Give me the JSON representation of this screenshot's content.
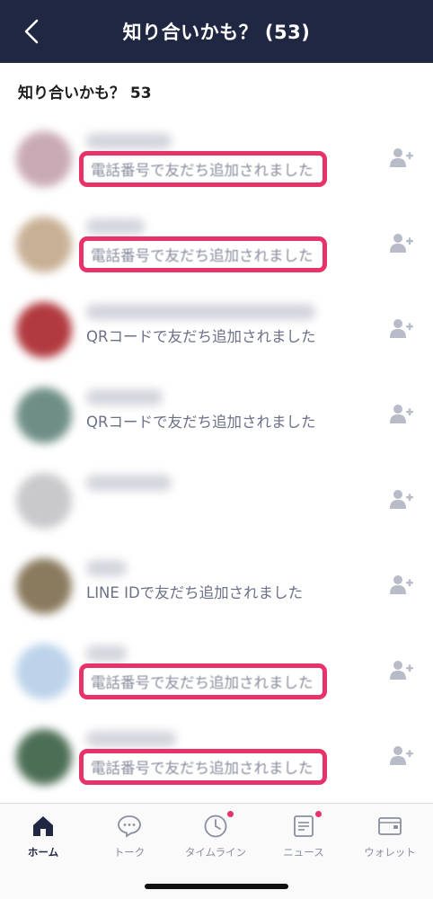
{
  "header": {
    "title": "知り合いかも？ (53)",
    "back_icon": "chevron-left-icon"
  },
  "section": {
    "title": "知り合いかも？ 53"
  },
  "suggestions": [
    {
      "avatar_color": "#c9aab4",
      "name_width": 95,
      "source": "電話番号で友だち追加されました",
      "highlighted": true
    },
    {
      "avatar_color": "#c8b095",
      "name_width": 65,
      "source": "電話番号で友だち追加されました",
      "highlighted": true
    },
    {
      "avatar_color": "#b13a3f",
      "name_width": 255,
      "source": "QRコードで友だち追加されました",
      "highlighted": false
    },
    {
      "avatar_color": "#6f8f86",
      "name_width": 85,
      "source": "QRコードで友だち追加されました",
      "highlighted": false
    },
    {
      "avatar_color": "#c9c9cc",
      "name_width": 95,
      "source": "",
      "highlighted": false
    },
    {
      "avatar_color": "#8a7a5e",
      "name_width": 45,
      "source": "LINE IDで友だち追加されました",
      "highlighted": false
    },
    {
      "avatar_color": "#bcd3ea",
      "name_width": 45,
      "source": "電話番号で友だち追加されました",
      "highlighted": true
    },
    {
      "avatar_color": "#4c6e55",
      "name_width": 100,
      "source": "電話番号で友だち追加されました",
      "highlighted": true
    }
  ],
  "tabs": [
    {
      "label": "ホーム",
      "icon": "home-icon",
      "active": true,
      "badge": false
    },
    {
      "label": "トーク",
      "icon": "chat-bubble-icon",
      "active": false,
      "badge": false
    },
    {
      "label": "タイムライン",
      "icon": "clock-icon",
      "active": false,
      "badge": true
    },
    {
      "label": "ニュース",
      "icon": "news-icon",
      "active": false,
      "badge": true
    },
    {
      "label": "ウォレット",
      "icon": "wallet-icon",
      "active": false,
      "badge": false
    }
  ],
  "colors": {
    "nav_bg": "#1f2742",
    "highlight": "#e8336a",
    "badge": "#e8336a",
    "secondary_text": "#6c7188"
  }
}
